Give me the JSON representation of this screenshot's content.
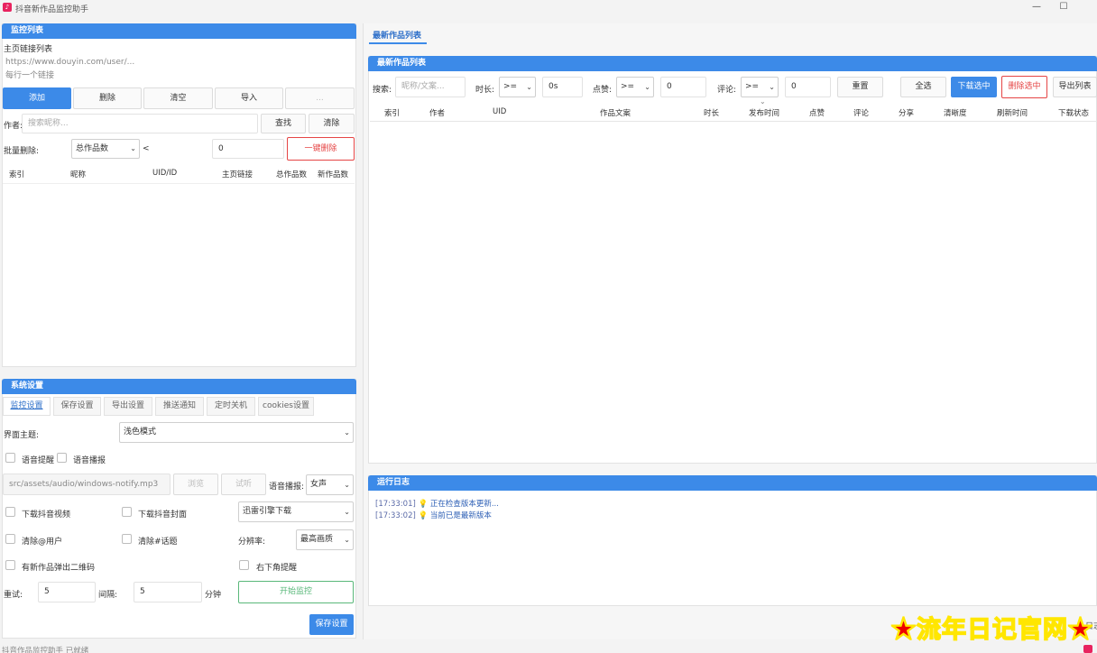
{
  "window": {
    "title": "抖音新作品监控助手",
    "minimize_glyph": "—",
    "maximize_glyph": "☐"
  },
  "monitor_list": {
    "header": "监控列表",
    "homepage_label": "主页链接列表",
    "url_placeholder": "https://www.douyin.com/user/...",
    "url_hint": "每行一个链接",
    "buttons": {
      "add": "添加",
      "delete": "删除",
      "clear": "清空",
      "import": "导入",
      "extra": "..."
    },
    "author_label": "作者:",
    "author_placeholder": "搜索昵称...",
    "find_btn": "查找",
    "clear_btn": "清除",
    "batch_label": "批量删除:",
    "batch_select": "总作品数",
    "batch_op": "<",
    "batch_value": "0",
    "one_click_delete": "一键删除",
    "columns": [
      "索引",
      "昵称",
      "UID/ID",
      "主页链接",
      "总作品数",
      "新作品数"
    ]
  },
  "settings": {
    "header": "系统设置",
    "tabs": [
      "监控设置",
      "保存设置",
      "导出设置",
      "推送通知",
      "定时关机",
      "cookies设置"
    ],
    "theme_label": "界面主题:",
    "theme_value": "浅色模式",
    "voice_remind": "语音提醒",
    "voice_broadcast": "语音播报",
    "sound_path": "src/assets/audio/windows-notify.mp3",
    "browse_btn": "浏览",
    "test_btn": "试听",
    "voice_label": "语音播报:",
    "voice_value": "女声",
    "download_video": "下载抖音视频",
    "download_cover": "下载抖音封面",
    "download_engine": "迅雷引擎下载",
    "remove_at": "清除@用户",
    "remove_topic": "清除#话题",
    "resolution_label": "分辨率:",
    "resolution_value": "最高画质",
    "qr_popup": "有新作品弹出二维码",
    "corner_remind": "右下角提醒",
    "retry_label": "重试:",
    "retry_value": "5",
    "interval_label": "间隔:",
    "interval_value": "5",
    "minute_unit": "分钟",
    "start_btn": "开始监控",
    "save_btn": "保存设置"
  },
  "works": {
    "tab": "最新作品列表",
    "header": "最新作品列表",
    "search_label": "搜索:",
    "search_placeholder": "昵称/文案...",
    "duration_label": "时长:",
    "duration_op": ">=",
    "duration_value": "0s",
    "likes_label": "点赞:",
    "likes_op": ">=",
    "likes_value": "0",
    "comments_label": "评论:",
    "comments_op": ">=",
    "comments_value": "0",
    "reset_btn": "重置",
    "select_all_btn": "全选",
    "download_selected_btn": "下载选中",
    "delete_selected_btn": "删除选中",
    "export_btn": "导出列表",
    "sort_indicator": "⌄",
    "columns": [
      "索引",
      "作者",
      "UID",
      "作品文案",
      "时长",
      "发布时间",
      "点赞",
      "评论",
      "分享",
      "清晰度",
      "刷新时间",
      "下载状态"
    ]
  },
  "log": {
    "header": "运行日志",
    "entries": [
      {
        "time": "[17:33:01]",
        "msg": "正在检查版本更新..."
      },
      {
        "time": "[17:33:02]",
        "msg": "当前已是最新版本"
      }
    ],
    "side_label": "日志"
  },
  "status_bar": "抖音作品监控助手 已就绪",
  "watermark": "★流年日记官网★",
  "colors": {
    "accent": "#3c8ae8",
    "danger": "#e54545",
    "success": "#5ab87a"
  }
}
